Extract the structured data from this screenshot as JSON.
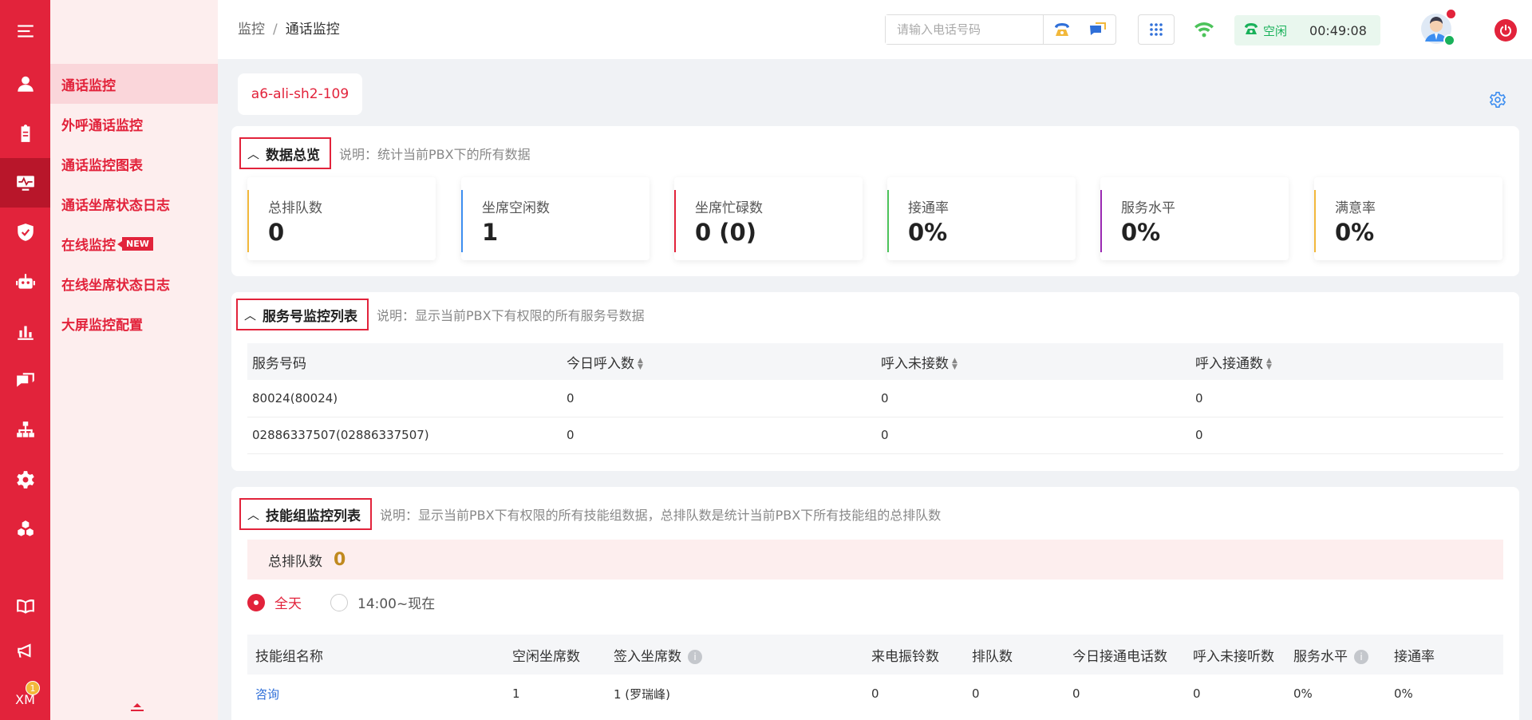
{
  "rail": {
    "items": [
      "menu-icon",
      "user-icon",
      "clipboard-icon",
      "monitor-icon",
      "shield-icon",
      "robot-icon",
      "chart-icon",
      "chat-icon",
      "org-icon",
      "gear-icon",
      "cubes-icon"
    ],
    "bottom": [
      "book-icon",
      "megaphone-icon"
    ],
    "xm_label": "XM",
    "xm_badge": "1"
  },
  "submenu": {
    "items": [
      {
        "label": "通话监控",
        "active": true
      },
      {
        "label": "外呼通话监控"
      },
      {
        "label": "通话监控图表"
      },
      {
        "label": "通话坐席状态日志"
      },
      {
        "label": "在线监控",
        "badge": "NEW"
      },
      {
        "label": "在线坐席状态日志"
      },
      {
        "label": "大屏监控配置"
      }
    ],
    "collapse_icon": "collapse-icon"
  },
  "topbar": {
    "breadcrumb": [
      "监控",
      "通话监控"
    ],
    "phone_placeholder": "请输入电话号码",
    "status_label": "空闲",
    "status_time": "00:49:08"
  },
  "server_tab": "a6-ali-sh2-109",
  "overview": {
    "title": "数据总览",
    "desc": "说明：统计当前PBX下的所有数据",
    "stats": [
      {
        "label": "总排队数",
        "value": "0",
        "color": "#f2b83b"
      },
      {
        "label": "坐席空闲数",
        "value": "1",
        "color": "#3d8ef0"
      },
      {
        "label": "坐席忙碌数",
        "value": "0 (0)",
        "color": "#e2233b"
      },
      {
        "label": "接通率",
        "value": "0%",
        "color": "#4cc35a"
      },
      {
        "label": "服务水平",
        "value": "0%",
        "color": "#9b2bb3"
      },
      {
        "label": "满意率",
        "value": "0%",
        "color": "#f2b83b"
      }
    ]
  },
  "service": {
    "title": "服务号监控列表",
    "desc": "说明：显示当前PBX下有权限的所有服务号数据",
    "columns": [
      "服务号码",
      "今日呼入数",
      "呼入未接数",
      "呼入接通数"
    ],
    "rows": [
      [
        "80024(80024)",
        "0",
        "0",
        "0"
      ],
      [
        "02886337507(02886337507)",
        "0",
        "0",
        "0"
      ]
    ]
  },
  "skill": {
    "title": "技能组监控列表",
    "desc": "说明：显示当前PBX下有权限的所有技能组数据，总排队数是统计当前PBX下所有技能组的总排队数",
    "queue_label": "总排队数",
    "queue_value": "0",
    "radio_all": "全天",
    "radio_range": "14:00~现在",
    "columns": [
      "技能组名称",
      "空闲坐席数",
      "签入坐席数",
      "来电振铃数",
      "排队数",
      "今日接通电话数",
      "呼入未接听数",
      "服务水平",
      "接通率"
    ],
    "rows": [
      [
        "咨询",
        "1",
        "1 (罗瑞峰)",
        "0",
        "0",
        "0",
        "0",
        "0%",
        "0%"
      ]
    ]
  },
  "colors": {
    "brand": "#e2233b",
    "success": "#19b15a",
    "link": "#2f6fd8"
  }
}
